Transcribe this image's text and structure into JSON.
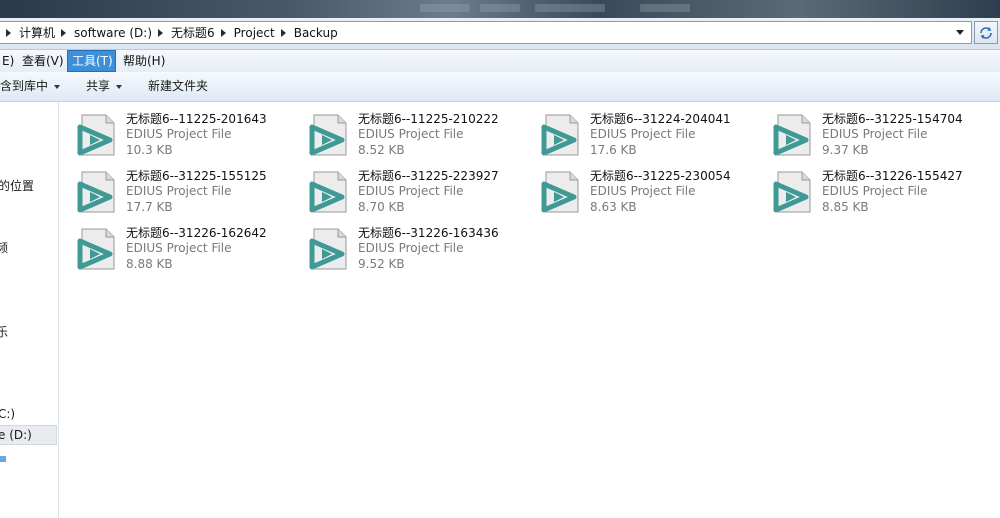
{
  "address": {
    "breadcrumbs": [
      "计算机",
      "software (D:)",
      "无标题6",
      "Project",
      "Backup"
    ]
  },
  "menu": {
    "items": [
      "E)",
      "查看(V)",
      "工具(T)",
      "帮助(H)"
    ],
    "active_index": 2
  },
  "commands": {
    "include_library": "包含到库中",
    "share": "共享",
    "new_folder": "新建文件夹"
  },
  "nav": {
    "items": [
      "的位置",
      "频",
      "乐",
      "C:)",
      "e (D:)"
    ]
  },
  "files": [
    {
      "name": "无标题6--11225-201643",
      "type": "EDIUS Project File",
      "size": "10.3 KB"
    },
    {
      "name": "无标题6--11225-210222",
      "type": "EDIUS Project File",
      "size": "8.52 KB"
    },
    {
      "name": "无标题6--31224-204041",
      "type": "EDIUS Project File",
      "size": "17.6 KB"
    },
    {
      "name": "无标题6--31225-154704",
      "type": "EDIUS Project File",
      "size": "9.37 KB"
    },
    {
      "name": "无标题6--31225-155125",
      "type": "EDIUS Project File",
      "size": "17.7 KB"
    },
    {
      "name": "无标题6--31225-223927",
      "type": "EDIUS Project File",
      "size": "8.70 KB"
    },
    {
      "name": "无标题6--31225-230054",
      "type": "EDIUS Project File",
      "size": "8.63 KB"
    },
    {
      "name": "无标题6--31226-155427",
      "type": "EDIUS Project File",
      "size": "8.85 KB"
    },
    {
      "name": "无标题6--31226-162642",
      "type": "EDIUS Project File",
      "size": "8.88 KB"
    },
    {
      "name": "无标题6--31226-163436",
      "type": "EDIUS Project File",
      "size": "9.52 KB"
    }
  ],
  "icons": {
    "file": "edius-project-file-icon",
    "refresh": "refresh-icon"
  },
  "colors": {
    "accent": "#3c8fd8",
    "edius_teal": "#3f9a95"
  }
}
